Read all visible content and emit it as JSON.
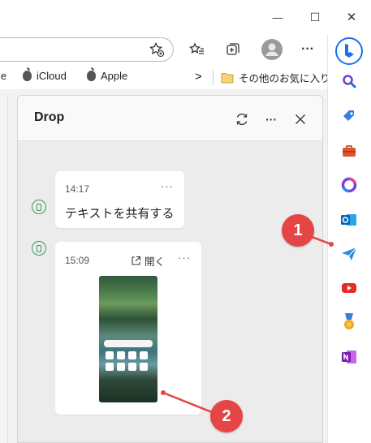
{
  "window": {
    "minimize_glyph": "—",
    "maximize_glyph": "☐",
    "close_glyph": "✕"
  },
  "toolbar": {
    "more_label": "···"
  },
  "bookmarks": {
    "items": [
      {
        "label": "le"
      },
      {
        "label": "iCloud"
      },
      {
        "label": "Apple"
      }
    ],
    "overflow_glyph": ">",
    "folder_label": "その他のお気に入り"
  },
  "drop": {
    "title": "Drop",
    "more_label": "···",
    "messages": [
      {
        "time": "14:17",
        "more": "···",
        "text": "テキストを共有する"
      },
      {
        "time": "15:09",
        "more": "···",
        "open_label": "開く"
      }
    ]
  },
  "annotations": [
    {
      "number": "1"
    },
    {
      "number": "2"
    }
  ],
  "colors": {
    "accent_red": "#e64545",
    "device_green": "#3a9a5a",
    "bing_blue": "#1a73e8"
  },
  "icons": {
    "sidebar": [
      "bing-icon",
      "search-icon",
      "tag-icon",
      "toolbox-icon",
      "office-icon",
      "outlook-icon",
      "drop-icon",
      "youtube-icon",
      "games-icon",
      "onenote-icon"
    ]
  }
}
